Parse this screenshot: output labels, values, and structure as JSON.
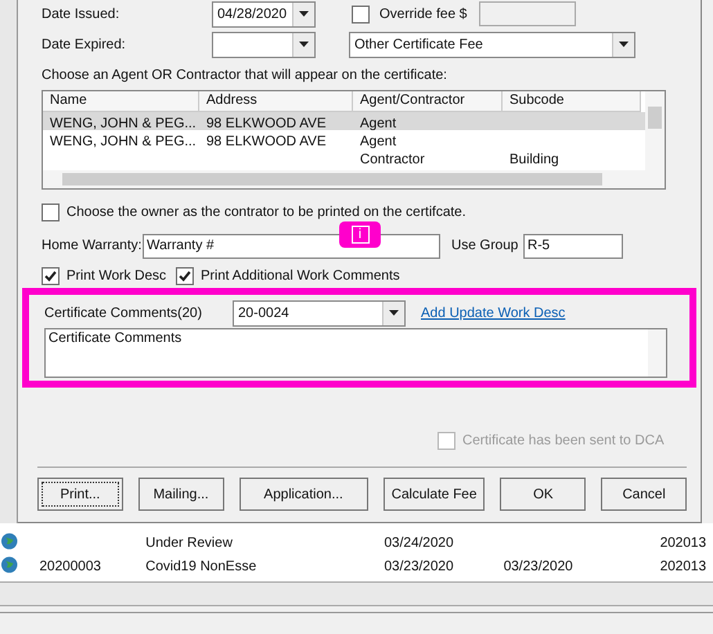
{
  "dates": [
    {
      "label": "Date Issued:",
      "value": "04/28/2020"
    },
    {
      "label": "Date Expired:"
    }
  ],
  "override_fee": {
    "label": "Override fee $",
    "checked": false
  },
  "fee_type": {
    "value": "Other Certificate Fee"
  },
  "agents": {
    "label": "Choose an Agent OR Contractor that will appear on the certificate:",
    "columns": [
      "Name",
      "Address",
      "Agent/Contractor",
      "Subcode"
    ],
    "rows": [
      {
        "cells": [
          "WENG, JOHN & PEG...",
          "98 ELKWOOD AVE",
          "Agent",
          ""
        ],
        "selected": true
      },
      {
        "cells": [
          "WENG, JOHN & PEG...",
          "98 ELKWOOD AVE",
          "Agent",
          ""
        ],
        "selected": false
      },
      {
        "cells": [
          "",
          "",
          "Contractor",
          "Building"
        ],
        "selected": false
      }
    ]
  },
  "owner_as_contractor": {
    "label": "Choose the owner as the contrator to be printed on the certifcate.",
    "checked": false
  },
  "home_warranty": {
    "label": "Home Warranty:",
    "value": "Warranty #"
  },
  "use_group": {
    "label": "Use Group",
    "value": "R-5"
  },
  "print_options": [
    {
      "label": "Print Work Desc",
      "checked": true
    },
    {
      "label": "Print Additional Work Comments",
      "checked": true
    }
  ],
  "callout": {
    "label": "i"
  },
  "comments": {
    "label": "Certificate Comments(20)",
    "value": "20-0024",
    "link": "Add Update Work Desc",
    "text": "Certificate Comments"
  },
  "sent_to_dca": {
    "label": "Certificate has been sent to DCA",
    "checked": false,
    "disabled": true
  },
  "buttons": [
    {
      "label": "Print...",
      "focused": true
    },
    {
      "label": "Mailing...",
      "focused": false
    },
    {
      "label": "Application...",
      "focused": false
    },
    {
      "label": "Calculate Fee",
      "focused": false
    },
    {
      "label": "OK",
      "focused": false
    },
    {
      "label": "Cancel",
      "focused": false
    }
  ],
  "background_rows": [
    {
      "cells": [
        "",
        "Under Review",
        "03/24/2020",
        "",
        "202013"
      ]
    },
    {
      "cells": [
        "20200003",
        "Covid19 NonEsse",
        "03/23/2020",
        "03/23/2020",
        "202013"
      ]
    }
  ]
}
